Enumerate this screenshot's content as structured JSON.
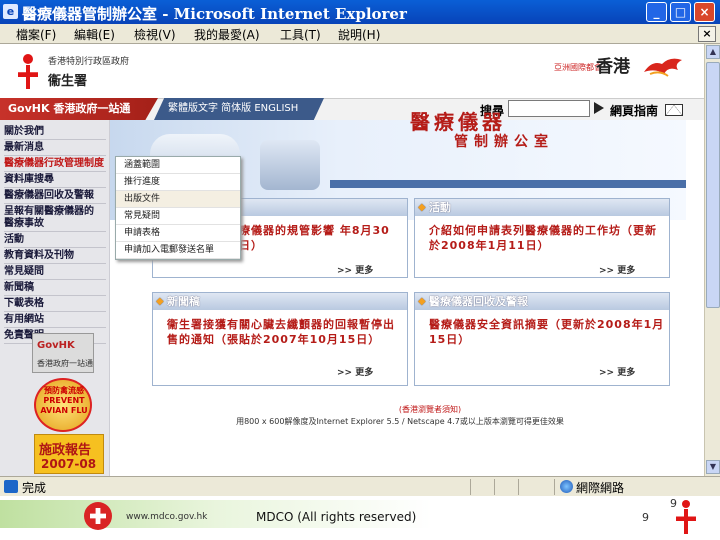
{
  "window": {
    "title": "醫療儀器管制辦公室 - Microsoft Internet Explorer",
    "controls": {
      "minimize": "_",
      "maximize": "□",
      "close": "×"
    }
  },
  "menubar": {
    "items": [
      "檔案(F)",
      "編輯(E)",
      "檢視(V)",
      "我的最愛(A)",
      "工具(T)",
      "說明(H)"
    ]
  },
  "header": {
    "gov_label": "香港特別行政區政府",
    "dept_label": "衞生署",
    "brand_label": "亞洲國際都會",
    "hk_label": "香港"
  },
  "navbar": {
    "govhk": "GovHK 香港政府一站通",
    "languages": "繁體版文字  简体版  ENGLISH",
    "search_label": "搜尋",
    "search_value": "",
    "sitemap": "網頁指南"
  },
  "leftnav": {
    "items": [
      "關於我們",
      "最新消息",
      "醫療儀器行政管理制度",
      "資料庫搜尋",
      "醫療儀器回收及警報",
      "呈報有關醫療儀器的",
      "醫療事故",
      "活動",
      "教育資料及刊物",
      "常見疑問",
      "新聞稿",
      "下載表格",
      "有用網站",
      "免責聲明"
    ],
    "govhk_badge": "GovHK",
    "govhk_badge_sub": "香港政府一站通",
    "avian_badge": "預防禽流感 PREVENT AVIAN FLU",
    "policy_badge_title": "施政報告",
    "policy_badge_year": "2007-08"
  },
  "banner": {
    "title": "醫療儀器",
    "subtitle": "管制辦公室"
  },
  "dropdown": {
    "items": [
      "涵蓋範圍",
      "推行進度",
      "出版文件",
      "常見疑問",
      "申請表格",
      "申請加入電郵發送名單"
    ]
  },
  "panels": {
    "top_left": {
      "body": "療儀器的規管影響 年8月30日）",
      "more": ">> 更多"
    },
    "top_right": {
      "heading": "活動",
      "body": "介紹如何申請表列醫療儀器的工作坊（更新於2008年1月11日）",
      "more": ">> 更多"
    },
    "bottom_left": {
      "heading": "新聞稿",
      "body": "衞生署接獲有關心臟去纖顫器的回報暫停出售的通知（張貼於2007年10月15日）",
      "more": ">> 更多"
    },
    "bottom_right": {
      "heading": "醫療儀器回收及警報",
      "body": "醫療儀器安全資訊摘要（更新於2008年1月15日）",
      "more": ">> 更多"
    }
  },
  "page_footer": {
    "note_title": "(香港瀏覽者須知)",
    "note": "用800 x 600解像度及Internet Explorer 5.5 / Netscape 4.7或以上版本瀏覽可得更佳效果"
  },
  "statusbar": {
    "status": "完成",
    "zone": "網際網路"
  },
  "slide_footer": {
    "url": "www.mdco.gov.hk",
    "copyright": "MDCO (All rights reserved)",
    "page_number": "9",
    "page_number_top": "9"
  }
}
